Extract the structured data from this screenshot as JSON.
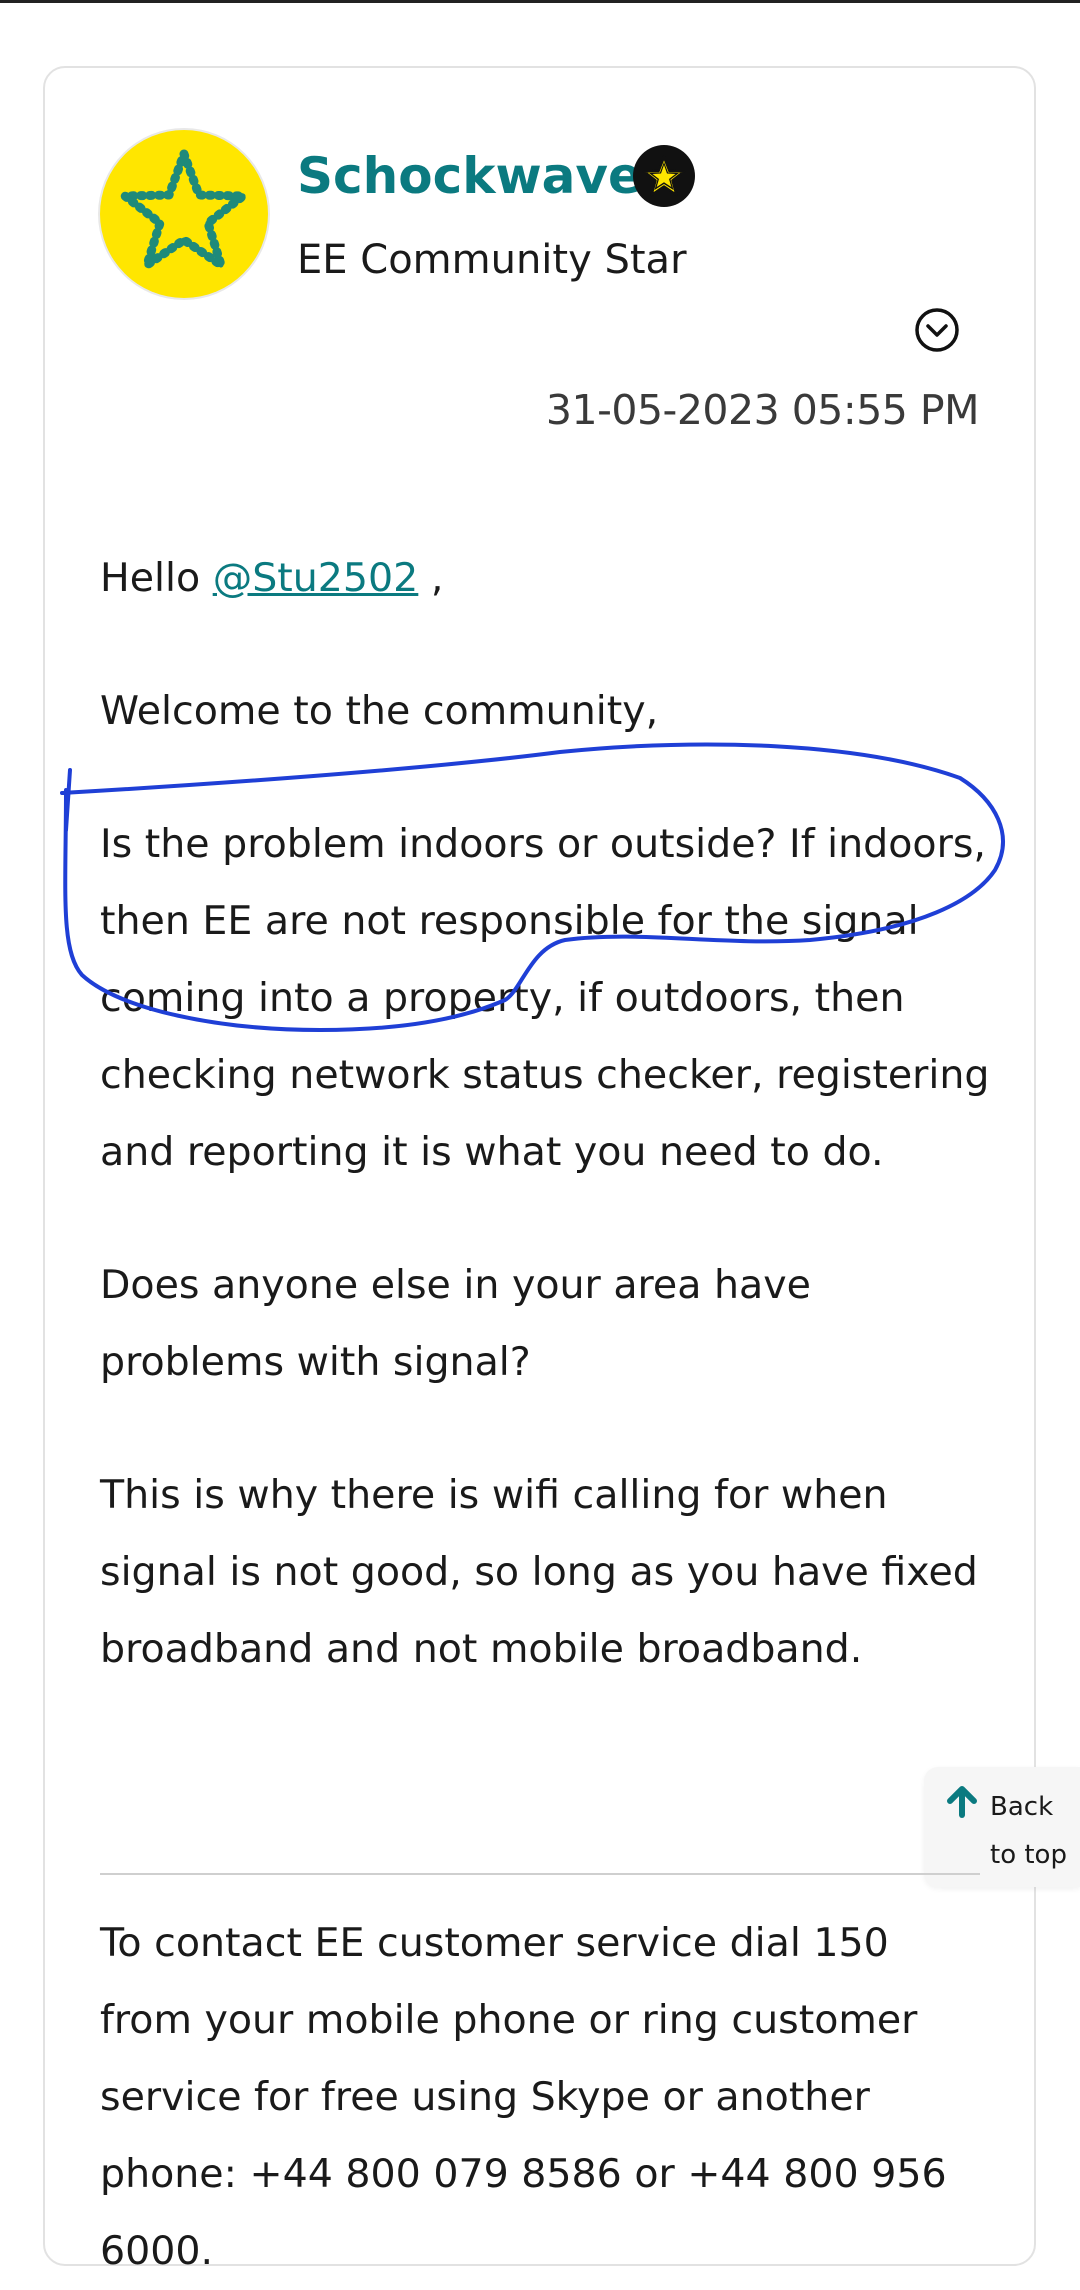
{
  "author": {
    "name": "Schockwave",
    "rank": "EE Community Star"
  },
  "post": {
    "date": "31-05-2023 05:55 PM",
    "greeting_prefix": "Hello ",
    "mention": "@Stu2502",
    "greeting_suffix": " ,",
    "paragraphs": [
      "Welcome to the community,",
      "Is the problem indoors or outside? If indoors, then EE are not responsible for the signal coming into a property, if outdoors, then checking network status checker, registering and reporting it is what you need to do.",
      "Does anyone else in your area have problems with signal?",
      "This is why there is wifi calling for when signal is not good, so long as you have fixed broadband and not mobile broadband."
    ],
    "signature": "To contact EE customer service dial 150 from your mobile phone or ring customer service for free using Skype or another phone: +44 800 079 8586 or +44 800 956 6000."
  },
  "back_to_top": {
    "label": "Back to top"
  },
  "icons": {
    "avatar": "star-icon",
    "rank_badge": "star-badge-icon",
    "options": "chevron-down-circle-icon",
    "back_to_top": "arrow-up-icon"
  },
  "colors": {
    "brand_teal": "#0b7a80",
    "avatar_yellow": "#ffe600",
    "annotation_blue": "#1f3fd6"
  }
}
